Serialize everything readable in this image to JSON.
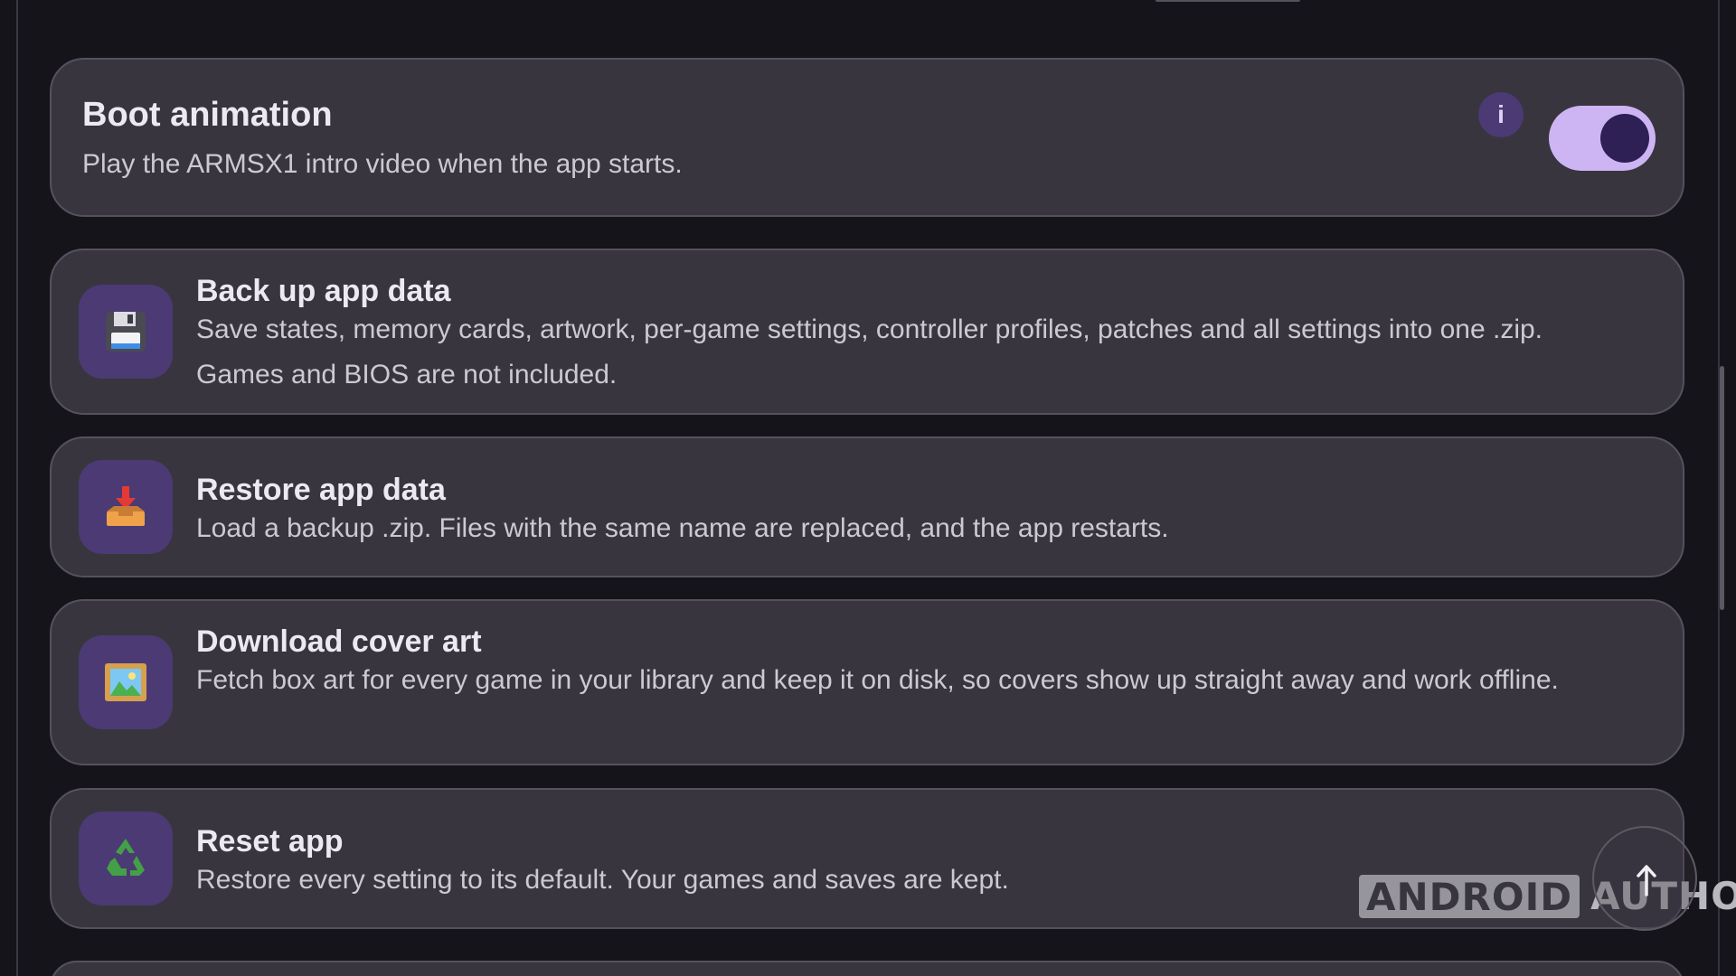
{
  "boot_animation": {
    "title": "Boot animation",
    "subtitle": "Play the ARMSX1 intro video when the app starts.",
    "info_label": "i",
    "enabled": true
  },
  "items": [
    {
      "title": "Back up app data",
      "subtitle": "Save states, memory cards, artwork, per-game settings, controller profiles, patches and all settings into one .zip. Games and BIOS are not included.",
      "icon": "floppy-disk-icon"
    },
    {
      "title": "Restore app data",
      "subtitle": "Load a backup .zip. Files with the same name are replaced, and the app restarts.",
      "icon": "inbox-tray-icon"
    },
    {
      "title": "Download cover art",
      "subtitle": "Fetch box art for every game in your library and keep it on disk, so covers show up straight away and work offline.",
      "icon": "framed-picture-icon"
    },
    {
      "title": "Reset app",
      "subtitle": "Restore every setting to its default. Your games and saves are kept.",
      "icon": "recycle-icon"
    }
  ],
  "watermark": {
    "boxed": "ANDROID",
    "plain": "AUTHORITY"
  },
  "scroll_top_button": {
    "icon": "arrow-up-icon"
  },
  "colors": {
    "background": "#16141b",
    "card": "#38353f",
    "card_border": "#55525d",
    "icon_tile": "#4b3a73",
    "toggle_track": "#cdb5f3",
    "toggle_knob": "#2e1f55",
    "title_text": "#ece9f1",
    "body_text": "#cdc9d3"
  }
}
